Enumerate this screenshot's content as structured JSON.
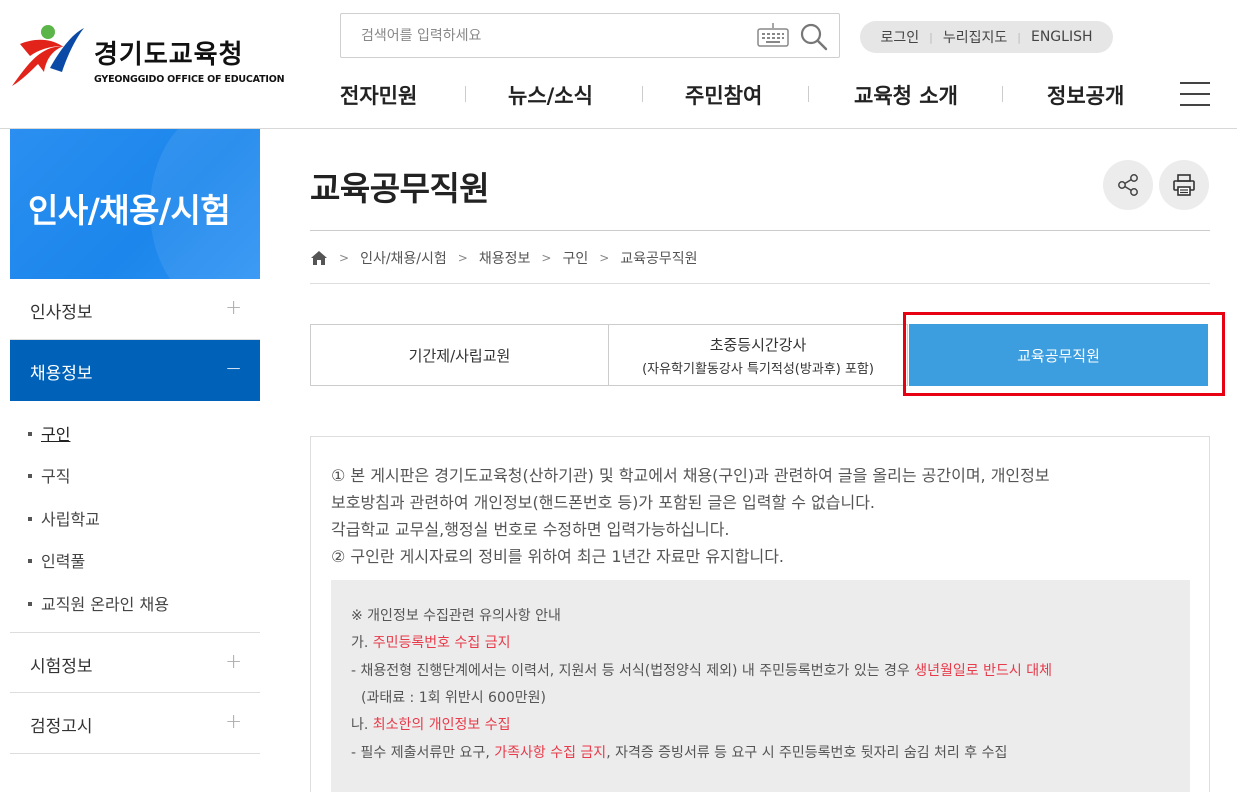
{
  "header": {
    "logo": {
      "ko": "경기도교육청",
      "en": "GYEONGGIDO OFFICE OF EDUCATION"
    },
    "search": {
      "placeholder": "검색어를 입력하세요"
    },
    "util": {
      "login": "로그인",
      "map": "누리집지도",
      "english": "ENGLISH"
    },
    "gnb": [
      "전자민원",
      "뉴스/소식",
      "주민참여",
      "교육청 소개",
      "정보공개"
    ]
  },
  "sidebar": {
    "title": "인사/채용/시험",
    "items": [
      {
        "label": "인사정보",
        "sign": "+"
      },
      {
        "label": "채용정보",
        "sign": "−"
      },
      {
        "label": "시험정보",
        "sign": "+"
      },
      {
        "label": "검정고시",
        "sign": "+"
      }
    ],
    "sub": [
      "구인",
      "구직",
      "사립학교",
      "인력풀",
      "교직원 온라인 채용"
    ]
  },
  "content": {
    "title": "교육공무직원",
    "breadcrumb": [
      "인사/채용/시험",
      "채용정보",
      "구인",
      "교육공무직원"
    ],
    "tabs": [
      {
        "line1": "기간제/사립교원",
        "line2": ""
      },
      {
        "line1": "초중등시간강사",
        "line2": "(자유학기활동강사 특기적성(방과후) 포함)"
      },
      {
        "line1": "교육공무직원",
        "line2": ""
      }
    ],
    "notice": {
      "p1": "① 본 게시판은 경기도교육청(산하기관) 및 학교에서 채용(구인)과 관련하여 글을 올리는 공간이며, 개인정보",
      "p2": "보호방침과 관련하여 개인정보(핸드폰번호 등)가 포함된 글은 입력할 수 없습니다.",
      "p3": "각급학교 교무실,행정실 번호로 수정하면 입력가능하십니다.",
      "p4": "② 구인란 게시자료의 정비를 위하여 최근 1년간 자료만 유지합니다."
    },
    "privacy": {
      "heading": "※ 개인정보 수집관련 유의사항 안내",
      "a_prefix": "가. ",
      "a_red": "주민등록번호 수집 금지",
      "a1_text": "- 채용전형 진행단계에서는 이력서, 지원서 등 서식(법정양식 제외) 내 주민등록번호가 있는 경우 ",
      "a1_red": "생년월일로 반드시 대체",
      "a2": "(과태료 : 1회 위반시 600만원)",
      "b_prefix": "나. ",
      "b_red": "최소한의 개인정보 수집",
      "b1_pre": "- 필수 제출서류만 요구, ",
      "b1_red": "가족사항 수집 금지",
      "b1_post": ", 자격증 증빙서류 등 요구 시 주민등록번호 뒷자리 숨김 처리 후 수집"
    }
  },
  "colors": {
    "sidebar_blue": "#2a8ff0",
    "active_nav": "#0061b9",
    "active_tab": "#3c9ddf",
    "highlight": "#e60012",
    "warn_red": "#e83a4a"
  }
}
